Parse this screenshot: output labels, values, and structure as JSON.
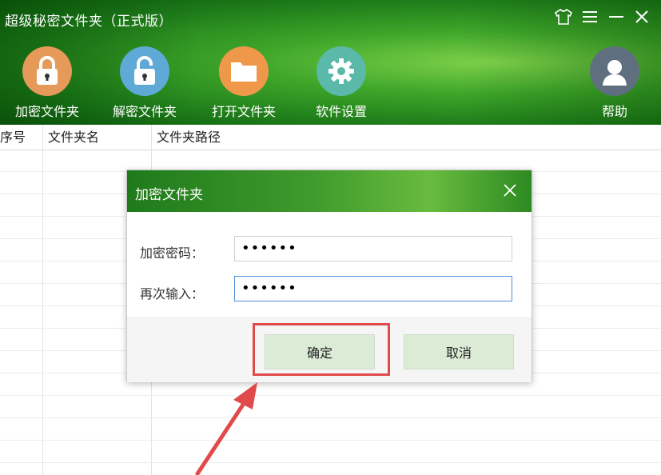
{
  "app": {
    "title": "超级秘密文件夹（正式版）",
    "window_controls": [
      "skin-icon",
      "menu-icon",
      "minimize-icon",
      "close-icon"
    ]
  },
  "toolbar": {
    "items": [
      {
        "label": "加密文件夹",
        "icon": "lock-closed-icon",
        "color": "#e59a5a"
      },
      {
        "label": "解密文件夹",
        "icon": "lock-open-icon",
        "color": "#5fa9d6"
      },
      {
        "label": "打开文件夹",
        "icon": "folder-icon",
        "color": "#f0984a"
      },
      {
        "label": "软件设置",
        "icon": "gear-icon",
        "color": "#5ab9a8"
      }
    ],
    "help": {
      "label": "帮助",
      "icon": "user-avatar-icon",
      "color": "#5f6f80"
    }
  },
  "table": {
    "columns": [
      "序号",
      "文件夹名",
      "文件夹路径"
    ]
  },
  "dialog": {
    "title": "加密文件夹",
    "password_label": "加密密码：",
    "password_value": "••••••",
    "confirm_label": "再次输入：",
    "confirm_value": "••••••",
    "ok_label": "确定",
    "cancel_label": "取消"
  },
  "colors": {
    "accent_green": "#2e8b22",
    "annotation_red": "#e04a4a",
    "button_bg": "#dcebd6"
  }
}
